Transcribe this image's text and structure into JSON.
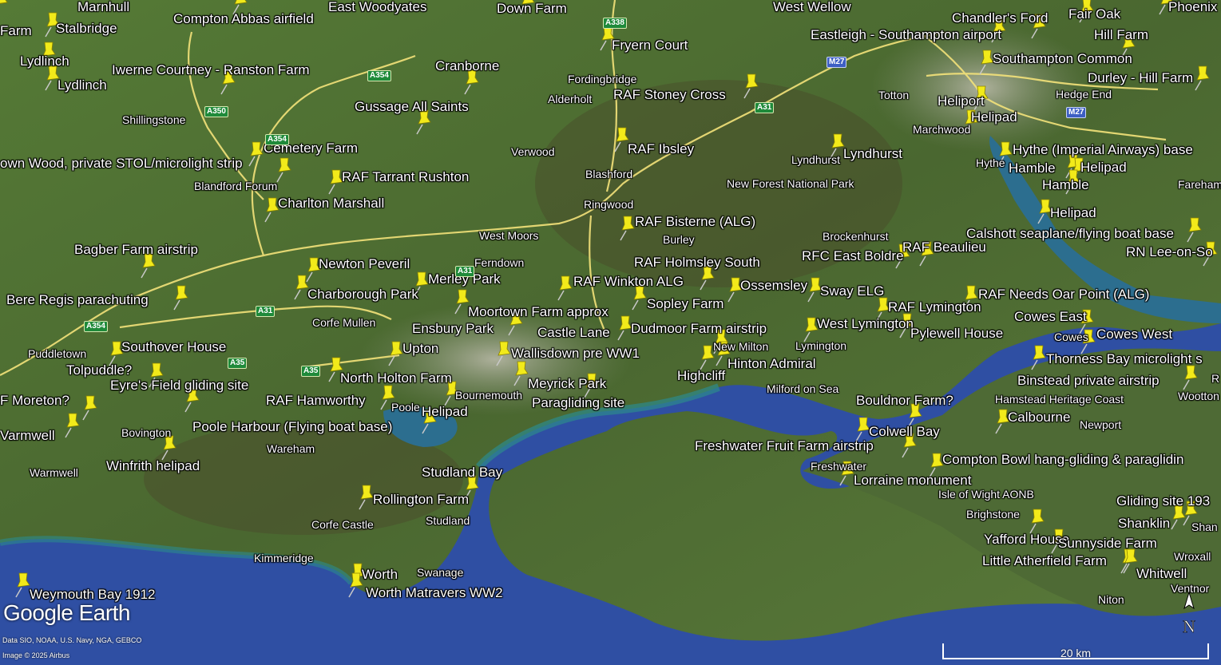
{
  "branding": {
    "logo": "Google Earth"
  },
  "credits": {
    "data_line": "Data SIO, NOAA, U.S. Navy, NGA, GEBCO",
    "image_line": "Image © 2025 Airbus"
  },
  "scale": {
    "label": "20 km"
  },
  "compass": {
    "label": "N"
  },
  "colors": {
    "land": "#4f6d33",
    "sea": "#2f4fa3",
    "shallows": "#2c8a8c",
    "pin": "#f2ea1a",
    "road": "#f3e27a",
    "motorway": "#f7f0b0"
  },
  "roads": [
    "A338",
    "A354",
    "A350",
    "A354",
    "A31",
    "A35",
    "A35",
    "A354",
    "A31",
    "A31",
    "M27",
    "M27"
  ],
  "pins": [
    {
      "label": "Stalbridge",
      "icon": "pushpin-icon"
    },
    {
      "label": "Compton Abbas airfield",
      "icon": "pushpin-icon"
    },
    {
      "label": "Down Farm",
      "icon": "pushpin-icon"
    },
    {
      "label": "Fryern Court",
      "icon": "pushpin-icon"
    },
    {
      "label": "Eastleigh - Southampton airport",
      "icon": "pushpin-icon"
    },
    {
      "label": "Chandler's Ford",
      "icon": "pushpin-icon"
    },
    {
      "label": "Hill Farm",
      "icon": "pushpin-icon"
    },
    {
      "label": "Lydlinch",
      "icon": "pushpin-icon"
    },
    {
      "label": "Lydlinch",
      "icon": "pushpin-icon"
    },
    {
      "label": "Iwerne Courtney - Ranston Farm",
      "icon": "pushpin-icon"
    },
    {
      "label": "Cranborne",
      "icon": "pushpin-icon"
    },
    {
      "label": "Southampton Common",
      "icon": "pushpin-icon"
    },
    {
      "label": "Durley - Hill Farm",
      "icon": "pushpin-icon"
    },
    {
      "label": "RAF Stoney Cross",
      "icon": "pushpin-icon"
    },
    {
      "label": "Gussage All Saints",
      "icon": "pushpin-icon"
    },
    {
      "label": "Heliport",
      "icon": "pushpin-icon"
    },
    {
      "label": "Helipad",
      "icon": "pushpin-icon"
    },
    {
      "label": "RAF Ibsley",
      "icon": "pushpin-icon"
    },
    {
      "label": "Lyndhurst",
      "icon": "pushpin-icon"
    },
    {
      "label": "Hythe (Imperial Airways) base",
      "icon": "pushpin-icon"
    },
    {
      "label": "Cemetery Farm",
      "icon": "pushpin-icon"
    },
    {
      "label": "own Wood, private STOL/microlight strip",
      "icon": "pushpin-icon"
    },
    {
      "label": "Hamble",
      "icon": "pushpin-icon"
    },
    {
      "label": "Helipad",
      "icon": "pushpin-icon"
    },
    {
      "label": "Hamble",
      "icon": "pushpin-icon"
    },
    {
      "label": "RAF Tarrant Rushton",
      "icon": "pushpin-icon"
    },
    {
      "label": "Charlton Marshall",
      "icon": "pushpin-icon"
    },
    {
      "label": "Helipad",
      "icon": "pushpin-icon"
    },
    {
      "label": "RAF Bisterne (ALG)",
      "icon": "pushpin-icon"
    },
    {
      "label": "Calshott seaplane/flying boat base",
      "icon": "pushpin-icon"
    },
    {
      "label": "Bagber Farm airstrip",
      "icon": "pushpin-icon"
    },
    {
      "label": "RAF Beaulieu",
      "icon": "pushpin-icon"
    },
    {
      "label": "RFC East Boldre",
      "icon": "pushpin-icon"
    },
    {
      "label": "RN Lee-on-So",
      "icon": "pushpin-icon"
    },
    {
      "label": "Newton Peveril",
      "icon": "pushpin-icon"
    },
    {
      "label": "RAF Holmsley South",
      "icon": "pushpin-icon"
    },
    {
      "label": "Merley Park",
      "icon": "pushpin-icon"
    },
    {
      "label": "RAF Winkton ALG",
      "icon": "pushpin-icon"
    },
    {
      "label": "Ossemsley",
      "icon": "pushpin-icon"
    },
    {
      "label": "Sway ELG",
      "icon": "pushpin-icon"
    },
    {
      "label": "RAF Needs Oar Point (ALG)",
      "icon": "pushpin-icon"
    },
    {
      "label": "Bere Regis parachuting",
      "icon": "pushpin-icon"
    },
    {
      "label": "Charborough Park",
      "icon": "pushpin-icon"
    },
    {
      "label": "Sopley Farm",
      "icon": "pushpin-icon"
    },
    {
      "label": "RAF Lymington",
      "icon": "pushpin-icon"
    },
    {
      "label": "Moortown Farm approx",
      "icon": "pushpin-icon"
    },
    {
      "label": "Cowes East",
      "icon": "pushpin-icon"
    },
    {
      "label": "Ensbury Park",
      "icon": "pushpin-icon"
    },
    {
      "label": "Castle Lane",
      "icon": "pushpin-icon"
    },
    {
      "label": "Dudmoor Farm airstrip",
      "icon": "pushpin-icon"
    },
    {
      "label": "West Lymington",
      "icon": "pushpin-icon"
    },
    {
      "label": "Pylewell House",
      "icon": "pushpin-icon"
    },
    {
      "label": "Cowes West",
      "icon": "pushpin-icon"
    },
    {
      "label": "Southover House",
      "icon": "pushpin-icon"
    },
    {
      "label": "Upton",
      "icon": "pushpin-icon"
    },
    {
      "label": "Wallisdown pre WW1",
      "icon": "pushpin-icon"
    },
    {
      "label": "Thorness Bay microlight s",
      "icon": "pushpin-icon"
    },
    {
      "label": "Hinton Admiral",
      "icon": "pushpin-icon"
    },
    {
      "label": "Tolpuddle?",
      "icon": "pushpin-icon"
    },
    {
      "label": "Highcliff",
      "icon": "pushpin-icon"
    },
    {
      "label": "North Holton Farm",
      "icon": "pushpin-icon"
    },
    {
      "label": "Binstead private airstrip",
      "icon": "pushpin-icon"
    },
    {
      "label": "Meyrick Park",
      "icon": "pushpin-icon"
    },
    {
      "label": "Eyre's Field gliding site",
      "icon": "pushpin-icon"
    },
    {
      "label": "F Moreton?",
      "icon": "pushpin-icon"
    },
    {
      "label": "RAF Hamworthy",
      "icon": "pushpin-icon"
    },
    {
      "label": "Paragliding site",
      "icon": "pushpin-icon"
    },
    {
      "label": "Bouldnor Farm?",
      "icon": "pushpin-icon"
    },
    {
      "label": "Helipad",
      "icon": "pushpin-icon"
    },
    {
      "label": "Calbourne",
      "icon": "pushpin-icon"
    },
    {
      "label": "Varmwell",
      "icon": "pushpin-icon"
    },
    {
      "label": "Poole Harbour (Flying boat base)",
      "icon": "pushpin-icon"
    },
    {
      "label": "Colwell Bay",
      "icon": "pushpin-icon"
    },
    {
      "label": "Freshwater Fruit Farm airstrip",
      "icon": "pushpin-icon"
    },
    {
      "label": "Winfrith helipad",
      "icon": "pushpin-icon"
    },
    {
      "label": "Compton Bowl hang-gliding &  paraglidin",
      "icon": "pushpin-icon"
    },
    {
      "label": "Studland Bay",
      "icon": "pushpin-icon"
    },
    {
      "label": "Lorraine monument",
      "icon": "pushpin-icon"
    },
    {
      "label": "Rollington Farm",
      "icon": "pushpin-icon"
    },
    {
      "label": "Gliding site 193",
      "icon": "pushpin-icon"
    },
    {
      "label": "Shanklin",
      "icon": "pushpin-icon"
    },
    {
      "label": "Yafford House",
      "icon": "pushpin-icon"
    },
    {
      "label": "Sunnyside Farm",
      "icon": "pushpin-icon"
    },
    {
      "label": "Little Atherfield Farm",
      "icon": "pushpin-icon"
    },
    {
      "label": "Whitwell",
      "icon": "pushpin-icon"
    },
    {
      "label": "Worth",
      "icon": "pushpin-icon"
    },
    {
      "label": "Worth Matravers WW2",
      "icon": "pushpin-icon"
    },
    {
      "label": "Weymouth Bay 1912",
      "icon": "pushpin-icon"
    },
    {
      "label": "Farm",
      "icon": "pushpin-icon"
    },
    {
      "label": "Phoenix F",
      "icon": "pushpin-icon"
    },
    {
      "label": "Fair Oak",
      "icon": "pushpin-icon"
    },
    {
      "label": "Marnhull",
      "icon": "pushpin-icon"
    },
    {
      "label": "East Woodyates",
      "icon": "pushpin-icon"
    },
    {
      "label": "West Wellow",
      "icon": "pushpin-icon"
    }
  ],
  "towns": [
    "Shillingstone",
    "Blandford Forum",
    "Fordingbridge",
    "Alderholt",
    "Verwood",
    "Blashford",
    "Ringwood",
    "Totton",
    "Marchwood",
    "Hedge End",
    "Lyndhurst",
    "New Forest National Park",
    "Hythe",
    "Fareham",
    "West Moors",
    "Ferndown",
    "Burley",
    "Brockenhurst",
    "Corfe Mullen",
    "Puddletown",
    "Bournemouth",
    "Poole",
    "New Milton",
    "Lymington",
    "Milford on Sea",
    "Cowes",
    "Hamstead Heritage Coast",
    "Newport",
    "Wootton Br",
    "Bovington",
    "Wareham",
    "Warmwell",
    "Freshwater",
    "Isle of Wight AONB",
    "Corfe Castle",
    "Studland",
    "Brighstone",
    "Kimmeridge",
    "Swanage",
    "Wroxall",
    "Shan",
    "Niton",
    "Ventnor",
    "R"
  ]
}
